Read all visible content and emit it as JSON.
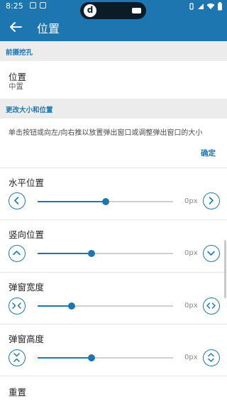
{
  "status_bar": {
    "time": "8:25"
  },
  "header": {
    "title": "位置"
  },
  "sections": {
    "cutout": "前摄挖孔",
    "size_position": "更改大小和位置"
  },
  "position_pref": {
    "title": "位置",
    "value": "中置"
  },
  "description": "单击按钮或向左/向右推以放置弹出窗口或调整弹出窗口的大小",
  "confirm_label": "确定",
  "sliders": [
    {
      "title": "水平位置",
      "value": 0,
      "unit": "px",
      "fraction": 0.5
    },
    {
      "title": "竖向位置",
      "value": 0,
      "unit": "px",
      "fraction": 0.4
    },
    {
      "title": "弹窗宽度",
      "value": 0,
      "unit": "px",
      "fraction": 0.25
    },
    {
      "title": "弹窗高度",
      "value": 0,
      "unit": "px",
      "fraction": 0.4
    }
  ],
  "reset_label": "重置",
  "colors": {
    "accent": "#1e76b0",
    "section_bg": "#ececec"
  },
  "icons": {
    "back": "arrow-left-icon",
    "status": [
      "signal-icon",
      "wifi-icon",
      "battery-icon"
    ]
  }
}
